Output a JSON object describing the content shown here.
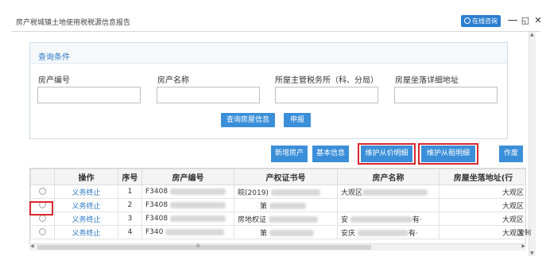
{
  "window": {
    "title": "房产税城镇土地使用税税源信息报告",
    "consult_label": "在线咨询",
    "minimize": "—",
    "restore": "◱",
    "close": "✕"
  },
  "query_panel": {
    "title": "查询条件",
    "fields": [
      {
        "label": "房产编号",
        "value": ""
      },
      {
        "label": "房产名称",
        "value": ""
      },
      {
        "label": "所屋主管税务所（科、分局）",
        "value": ""
      },
      {
        "label": "房屋坐落详细地址",
        "value": ""
      }
    ],
    "query_button": "查询房屋信息",
    "report_button": "申报"
  },
  "toolbar": {
    "buttons": [
      "新增房产",
      "基本信息",
      "维护从价明细",
      "维护从租明细",
      "作废"
    ]
  },
  "table": {
    "columns": [
      "",
      "操作",
      "序号",
      "房产编号",
      "产权证书号",
      "房产名称",
      "房屋坐落地址(行"
    ],
    "rows": [
      {
        "op": "义务终止",
        "seq": "1",
        "code": "F3408",
        "cert": "皖(2019)",
        "name": "大观区",
        "addr": "大观区"
      },
      {
        "op": "义务终止",
        "seq": "2",
        "code": "F3408",
        "cert": "第",
        "name": "",
        "addr": "大观区"
      },
      {
        "op": "义务终止",
        "seq": "3",
        "code": "F3408",
        "cert": "房地权证",
        "name": "安",
        "name_tail": "有·",
        "addr": "大观区"
      },
      {
        "op": "义务终止",
        "seq": "4",
        "code": "F340",
        "cert": "第",
        "name": "安庆",
        "name_tail": "有·",
        "addr": "大观区"
      }
    ]
  },
  "scroll": {
    "grip": "Ⅲ"
  },
  "side_label": "复制",
  "colors": {
    "accent": "#3b8fd9",
    "link": "#2b78c5",
    "highlight": "#d9272e"
  }
}
